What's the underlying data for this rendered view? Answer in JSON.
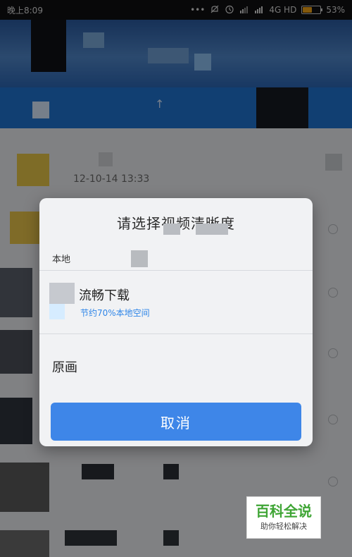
{
  "status_bar": {
    "time": "晚上8:09",
    "network": "4G HD",
    "battery_percent": "53%",
    "battery_level": 0.53,
    "icons": [
      "more-dots-icon",
      "mute-icon",
      "alarm-icon",
      "signal-icon",
      "signal-icon",
      "battery-icon"
    ]
  },
  "background": {
    "list_timestamp": "12-10-14 13:33"
  },
  "dialog": {
    "title": "请选择视频清晰度",
    "subtitle": "本地",
    "options": [
      {
        "label": "流畅下载",
        "note": "节约70%本地空间"
      },
      {
        "label": "原画"
      }
    ],
    "cancel_label": "取消"
  },
  "watermark": {
    "brand": "百科全说",
    "slogan": "助你轻松解决"
  },
  "colors": {
    "toolbar_blue": "#1f73d0",
    "cancel_blue": "#3e86e8",
    "note_blue": "#2f86e8",
    "watermark_green": "#3fa535",
    "battery_orange": "#f0a316"
  }
}
